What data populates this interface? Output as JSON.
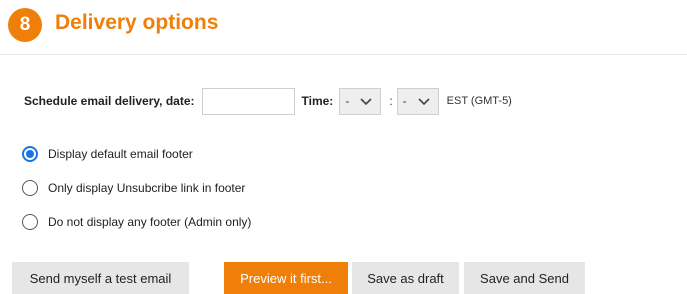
{
  "section": {
    "step_number": "8",
    "title": "Delivery options"
  },
  "schedule": {
    "date_label": "Schedule email delivery, date:",
    "date_value": "",
    "time_label": "Time:",
    "hour_value": "-",
    "colon": ":",
    "minute_value": "-",
    "timezone": "EST (GMT-5)"
  },
  "footer_options": [
    {
      "label": "Display default email footer",
      "selected": true
    },
    {
      "label": "Only display Unsubcribe link in footer",
      "selected": false
    },
    {
      "label": "Do not display any footer (Admin only)",
      "selected": false
    }
  ],
  "actions": {
    "test_email": "Send myself a test email",
    "preview": "Preview it first...",
    "save_draft": "Save as draft",
    "save_send": "Save and Send"
  },
  "colors": {
    "accent": "#f07f09",
    "radio_selected": "#1a73e8",
    "button_grey": "#e6e6e6"
  }
}
